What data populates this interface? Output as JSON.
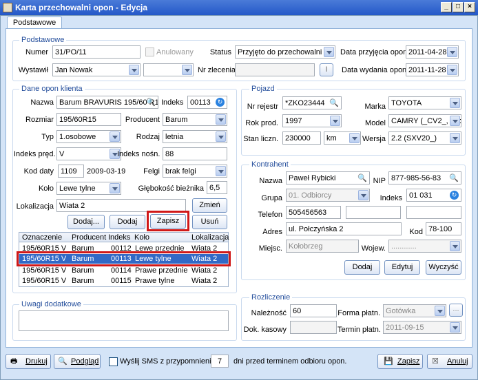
{
  "window": {
    "title": "Karta przechowalni opon - Edycja",
    "tab": "Podstawowe"
  },
  "podstawowe": {
    "title": "Podstawowe",
    "numer_label": "Numer",
    "numer": "31/PO/11",
    "anulowany": "Anulowany",
    "status_label": "Status",
    "status": "Przyjęto do przechowalni",
    "data_przyjecia_label": "Data przyjęcia opon",
    "data_przyjecia": "2011-04-28",
    "wystawil_label": "Wystawił",
    "wystawil": "Jan Nowak",
    "wystawil2": "",
    "nr_zlecenia_label": "Nr zlecenia",
    "nr_zlecenia": "",
    "info_btn": "I",
    "data_wydania_label": "Data wydania opon",
    "data_wydania": "2011-11-28"
  },
  "dane": {
    "title": "Dane opon klienta",
    "nazwa_label": "Nazwa",
    "nazwa": "Barum BRAVURIS 195/60 R1",
    "indeks_label": "Indeks",
    "indeks": "00113",
    "rozmiar_label": "Rozmiar",
    "rozmiar": "195/60R15",
    "producent_label": "Producent",
    "producent": "Barum",
    "typ_label": "Typ",
    "typ": "1.osobowe",
    "rodzaj_label": "Rodzaj",
    "rodzaj": "letnia",
    "indeks_pred_label": "Indeks pręd.",
    "indeks_pred": "V",
    "indeks_nosn_label": "Indeks nośn.",
    "indeks_nosn": "88",
    "kod_daty_label": "Kod daty",
    "kod_daty": "1109",
    "kod_daty_date": "2009-03-19",
    "felgi_label": "Felgi",
    "felgi": "brak felgi",
    "kolo_label": "Koło",
    "kolo": "Lewe tylne",
    "glebokosc_label": "Głębokość bieżnika",
    "glebokosc": "6,5",
    "lokalizacja_label": "Lokalizacja",
    "lokalizacja": "Wiata 2",
    "zmien": "Zmień",
    "dodaj_dots": "Dodaj...",
    "dodaj": "Dodaj",
    "zapisz": "Zapisz",
    "usun": "Usuń"
  },
  "grid": {
    "headers": [
      "Oznaczenie",
      "Producent",
      "Indeks",
      "Koło",
      "Lokalizacja"
    ],
    "rows": [
      {
        "oznaczenie": "195/60R15 V",
        "producent": "Barum",
        "indeks": "00112",
        "kolo": "Lewe przednie",
        "lokalizacja": "Wiata 2"
      },
      {
        "oznaczenie": "195/60R15 V",
        "producent": "Barum",
        "indeks": "00113",
        "kolo": "Lewe tylne",
        "lokalizacja": "Wiata 2"
      },
      {
        "oznaczenie": "195/60R15 V",
        "producent": "Barum",
        "indeks": "00114",
        "kolo": "Prawe przednie",
        "lokalizacja": "Wiata 2"
      },
      {
        "oznaczenie": "195/60R15 V",
        "producent": "Barum",
        "indeks": "00115",
        "kolo": "Prawe tylne",
        "lokalizacja": "Wiata 2"
      }
    ]
  },
  "uwagi": {
    "title": "Uwagi dodatkowe",
    "text": ""
  },
  "pojazd": {
    "title": "Pojazd",
    "nr_rej_label": "Nr rejestr",
    "nr_rej": "*ZKO23444",
    "marka_label": "Marka",
    "marka": "TOYOTA",
    "rok_label": "Rok prod.",
    "rok": "1997",
    "model_label": "Model",
    "model": "CAMRY (_CV2_, _V:",
    "stan_label": "Stan liczn.",
    "stan": "230000",
    "stan_unit": "km",
    "wersja_label": "Wersja",
    "wersja": "2.2 (SXV20_)"
  },
  "kontrahent": {
    "title": "Kontrahent",
    "nazwa_label": "Nazwa",
    "nazwa": "Paweł Rybicki",
    "nip_label": "NIP",
    "nip": "877-985-56-83",
    "grupa_label": "Grupa",
    "grupa": "01. Odbiorcy",
    "indeks_label": "Indeks",
    "indeks": "01 031",
    "telefon_label": "Telefon",
    "telefon": "505456563",
    "adres_label": "Adres",
    "adres": "ul. Połczyńska 2",
    "kod_label": "Kod",
    "kod": "78-100",
    "miejsc_label": "Miejsc.",
    "miejsc": "Kołobrzeg",
    "wojew_label": "Wojew.",
    "wojew": "............",
    "dodaj": "Dodaj",
    "edytuj": "Edytuj",
    "wyczysc": "Wyczyść"
  },
  "rozliczenie": {
    "title": "Rozliczenie",
    "naleznosc_label": "Należność",
    "naleznosc": "60",
    "forma_label": "Forma płatn.",
    "forma": "Gotówka",
    "dots": "...",
    "dok_label": "Dok. kasowy",
    "dok": "",
    "termin_label": "Termin płatn.",
    "termin": "2011-09-15"
  },
  "footer": {
    "drukuj": "Drukuj",
    "podglad": "Podgląd",
    "sms_label": "Wyślij SMS z przypomnieniem",
    "sms_days": "7",
    "sms_suffix": "dni przed terminem odbioru opon.",
    "zapisz": "Zapisz",
    "anuluj": "Anuluj"
  },
  "colors": {
    "accent": "#3169c6",
    "highlight": "#d01818",
    "group_title": "#244e9c"
  }
}
